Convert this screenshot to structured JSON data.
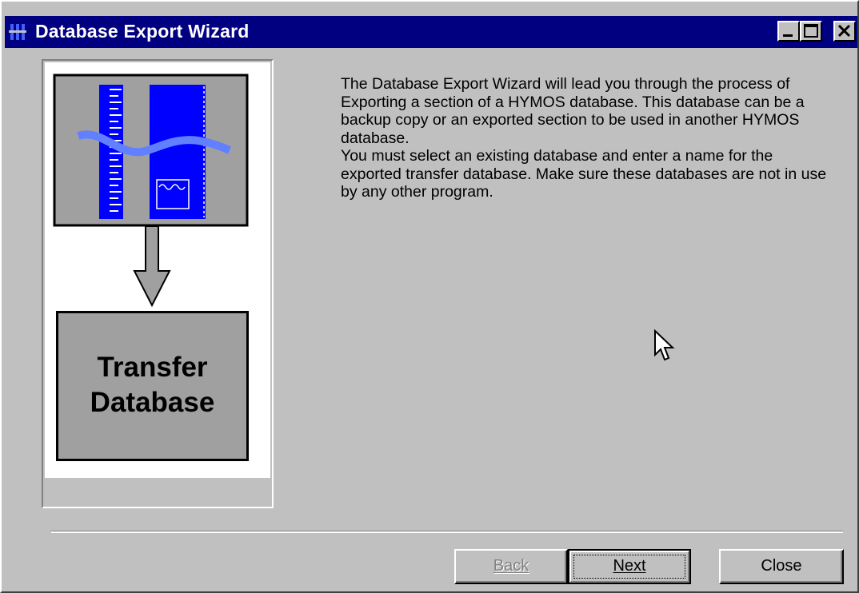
{
  "window": {
    "title": "Database Export Wizard"
  },
  "illustration": {
    "box_label_line1": "Transfer",
    "box_label_line2": "Database"
  },
  "description": {
    "paragraph1": "The Database Export Wizard will lead you through the process of Exporting a section of a HYMOS database. This database can be a backup copy or an exported section to be used in another HYMOS database.",
    "paragraph2": "You must select an existing database and enter a name for the exported transfer database. Make sure these databases are not in use by any other program."
  },
  "buttons": {
    "back": "Back",
    "next": "Next",
    "close": "Close"
  },
  "colors": {
    "titlebar": "#000080",
    "face": "#c0c0c0",
    "illustration_blue": "#0000ff",
    "illustration_wave": "#6080ff"
  }
}
